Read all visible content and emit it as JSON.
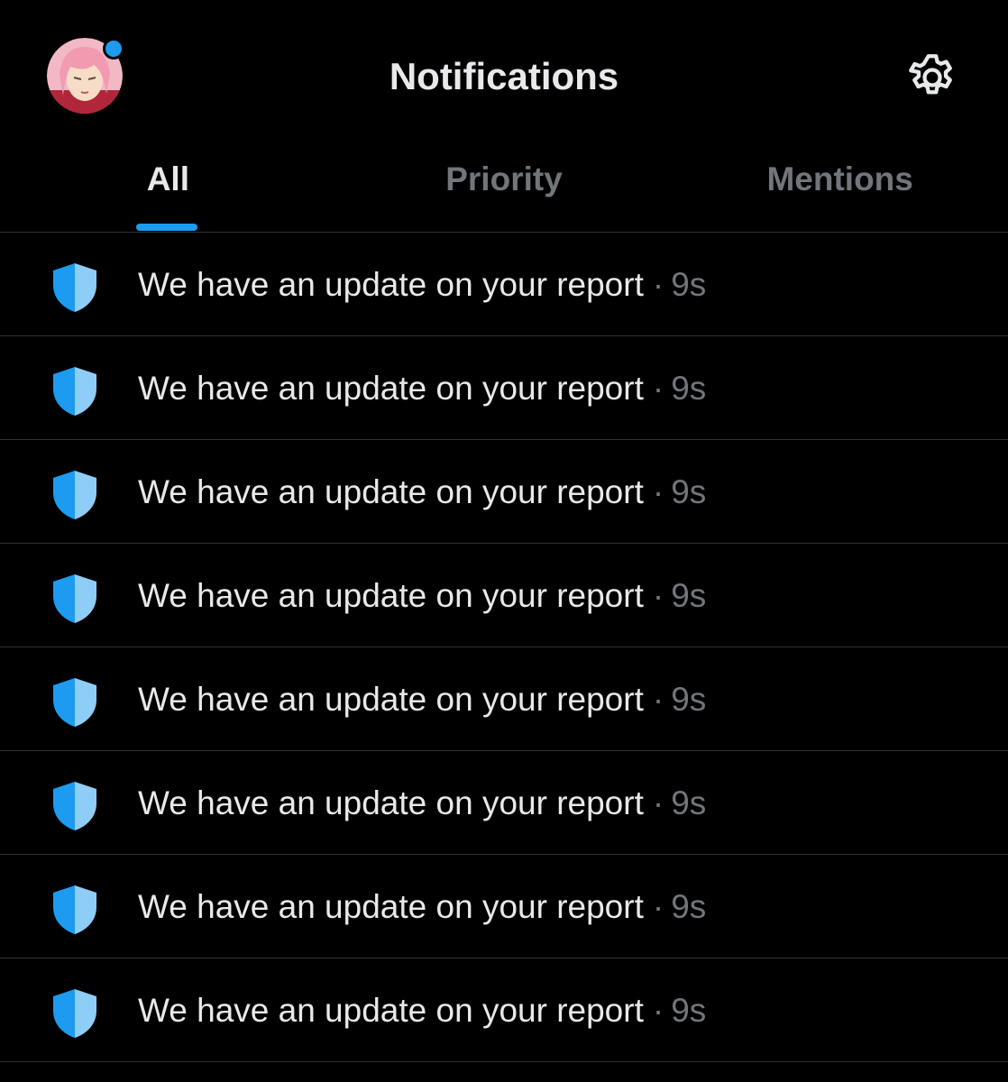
{
  "header": {
    "title": "Notifications",
    "avatar_icon": "user-avatar",
    "settings_icon": "gear-icon",
    "badge_color": "#1d9bf0"
  },
  "tabs": [
    {
      "label": "All",
      "active": true
    },
    {
      "label": "Priority",
      "active": false
    },
    {
      "label": "Mentions",
      "active": false
    }
  ],
  "notifications": [
    {
      "text": "We have an update on your report",
      "separator": "·",
      "time": "9s",
      "icon": "shield-icon"
    },
    {
      "text": "We have an update on your report",
      "separator": "·",
      "time": "9s",
      "icon": "shield-icon"
    },
    {
      "text": "We have an update on your report",
      "separator": "·",
      "time": "9s",
      "icon": "shield-icon"
    },
    {
      "text": "We have an update on your report",
      "separator": "·",
      "time": "9s",
      "icon": "shield-icon"
    },
    {
      "text": "We have an update on your report",
      "separator": "·",
      "time": "9s",
      "icon": "shield-icon"
    },
    {
      "text": "We have an update on your report",
      "separator": "·",
      "time": "9s",
      "icon": "shield-icon"
    },
    {
      "text": "We have an update on your report",
      "separator": "·",
      "time": "9s",
      "icon": "shield-icon"
    },
    {
      "text": "We have an update on your report",
      "separator": "·",
      "time": "9s",
      "icon": "shield-icon"
    }
  ],
  "colors": {
    "accent": "#1d9bf0",
    "shield_dark": "#1d9bf0",
    "shield_light": "#8ecdf8",
    "text_primary": "#e7e9ea",
    "text_secondary": "#71767b",
    "divider": "#2f3336"
  }
}
